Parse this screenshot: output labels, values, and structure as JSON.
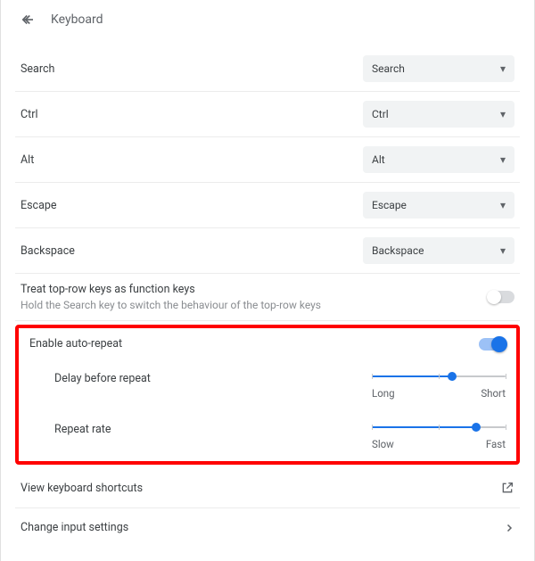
{
  "header": {
    "title": "Keyboard"
  },
  "keymaps": [
    {
      "label": "Search",
      "value": "Search"
    },
    {
      "label": "Ctrl",
      "value": "Ctrl"
    },
    {
      "label": "Alt",
      "value": "Alt"
    },
    {
      "label": "Escape",
      "value": "Escape"
    },
    {
      "label": "Backspace",
      "value": "Backspace"
    }
  ],
  "top_row": {
    "label": "Treat top-row keys as function keys",
    "sublabel": "Hold the Search key to switch the behaviour of the top-row keys",
    "enabled": false
  },
  "auto_repeat": {
    "label": "Enable auto-repeat",
    "enabled": true,
    "delay": {
      "label": "Delay before repeat",
      "left": "Long",
      "right": "Short",
      "pct": 60
    },
    "rate": {
      "label": "Repeat rate",
      "left": "Slow",
      "right": "Fast",
      "pct": 78
    }
  },
  "links": {
    "shortcuts": "View keyboard shortcuts",
    "input": "Change input settings"
  }
}
